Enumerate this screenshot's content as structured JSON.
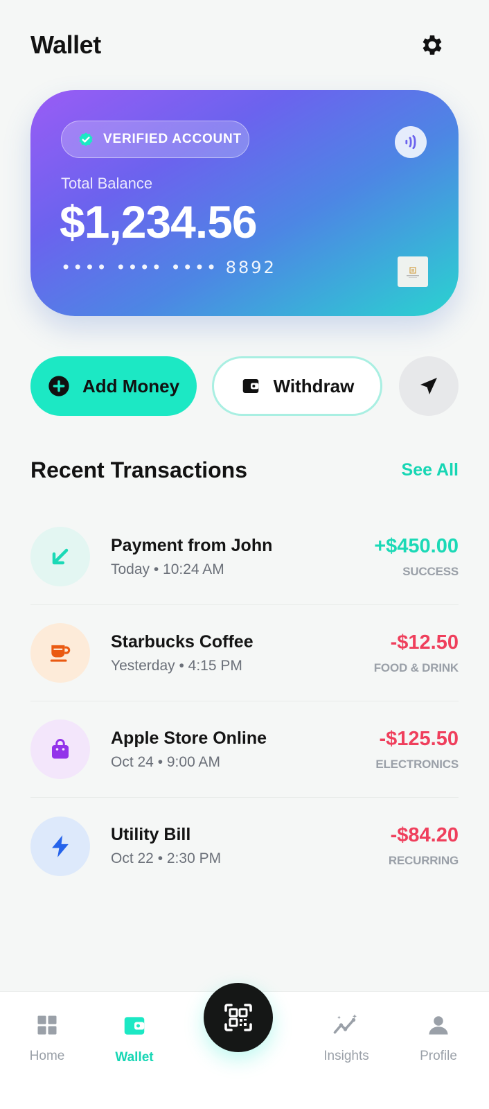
{
  "header": {
    "title": "Wallet"
  },
  "card": {
    "badge": "VERIFIED ACCOUNT",
    "balance_label": "Total Balance",
    "balance": "$1,234.56",
    "card_number": "•••• •••• •••• 8892"
  },
  "actions": {
    "add_money": "Add Money",
    "withdraw": "Withdraw"
  },
  "transactions": {
    "title": "Recent Transactions",
    "see_all": "See All",
    "items": [
      {
        "name": "Payment from John",
        "meta": "Today • 10:24 AM",
        "amount": "+$450.00",
        "tag": "SUCCESS",
        "icon": "arrow-down-left-icon",
        "color": "#1bd9b6",
        "bg": "#e3f6f2"
      },
      {
        "name": "Starbucks Coffee",
        "meta": "Yesterday • 4:15 PM",
        "amount": "-$12.50",
        "tag": "FOOD & DRINK",
        "icon": "coffee-icon",
        "color": "#ea5a12",
        "bg": "#fdebd9"
      },
      {
        "name": "Apple Store Online",
        "meta": "Oct 24 • 9:00 AM",
        "amount": "-$125.50",
        "tag": "ELECTRONICS",
        "icon": "shopping-bag-icon",
        "color": "#9333ea",
        "bg": "#f3e6fb"
      },
      {
        "name": "Utility Bill",
        "meta": "Oct 22 • 2:30 PM",
        "amount": "-$84.20",
        "tag": "RECURRING",
        "icon": "lightning-icon",
        "color": "#2563eb",
        "bg": "#dde9fb"
      }
    ]
  },
  "nav": {
    "home": "Home",
    "wallet": "Wallet",
    "insights": "Insights",
    "profile": "Profile"
  },
  "colors": {
    "accent": "#1ce8c4",
    "negative": "#ef3f5c"
  }
}
